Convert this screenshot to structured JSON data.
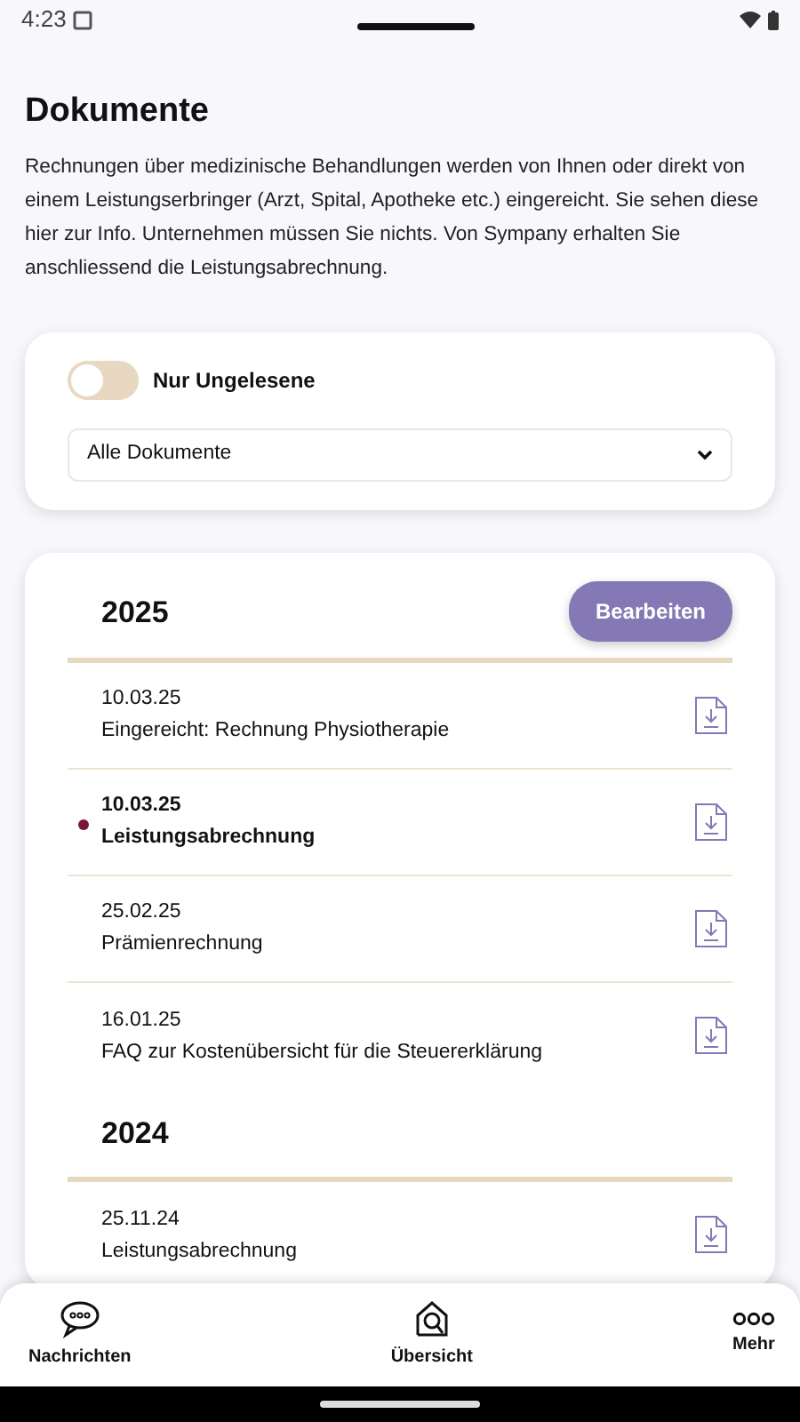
{
  "status_bar": {
    "time": "4:23"
  },
  "title": "Dokumente",
  "intro": "Rechnungen über medizinische Behandlungen werden von Ihnen oder direkt von einem Leistungserbringer (Arzt, Spital, Apotheke etc.) eingereicht. Sie sehen diese hier zur Info. Unternehmen müssen Sie nichts. Von Sympany erhalten Sie anschliessend die Leistungsabrechnung.",
  "filter": {
    "toggle": {
      "label": "Nur Ungelesene",
      "on": false
    },
    "select": {
      "value": "Alle Dokumente"
    }
  },
  "edit_button": "Bearbeiten",
  "groups": [
    {
      "year": "2025",
      "documents": [
        {
          "date": "10.03.25",
          "title": "Eingereicht: Rechnung Physiotherapie",
          "unread": false
        },
        {
          "date": "10.03.25",
          "title": "Leistungsabrechnung",
          "unread": true
        },
        {
          "date": "25.02.25",
          "title": "Prämienrechnung",
          "unread": false
        },
        {
          "date": "16.01.25",
          "title": "FAQ zur Kostenübersicht für die Steuererklärung",
          "unread": false
        }
      ]
    },
    {
      "year": "2024",
      "documents": [
        {
          "date": "25.11.24",
          "title": "Leistungsabrechnung",
          "unread": false
        }
      ]
    }
  ],
  "bottom_nav": [
    {
      "label": "Nachrichten",
      "kind": "chat"
    },
    {
      "label": "Übersicht",
      "kind": "home"
    },
    {
      "label": "Mehr",
      "kind": "more"
    }
  ]
}
